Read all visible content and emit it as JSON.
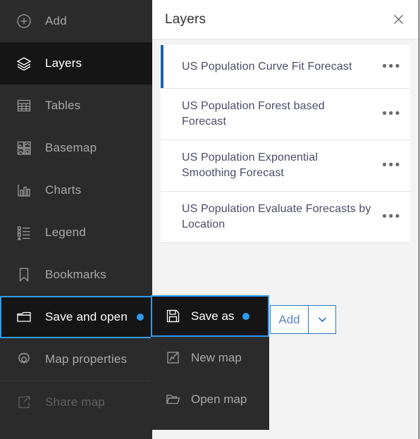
{
  "sidebar": {
    "items": [
      {
        "label": "Add",
        "icon": "plus-circle-icon",
        "state": "normal"
      },
      {
        "label": "Layers",
        "icon": "layers-icon",
        "state": "active"
      },
      {
        "label": "Tables",
        "icon": "table-icon",
        "state": "normal"
      },
      {
        "label": "Basemap",
        "icon": "basemap-icon",
        "state": "normal"
      },
      {
        "label": "Charts",
        "icon": "charts-icon",
        "state": "normal"
      },
      {
        "label": "Legend",
        "icon": "legend-icon",
        "state": "normal"
      },
      {
        "label": "Bookmarks",
        "icon": "bookmark-icon",
        "state": "normal"
      },
      {
        "label": "Save and open",
        "icon": "folder-icon",
        "state": "active-focused"
      },
      {
        "label": "Map properties",
        "icon": "gear-icon",
        "state": "normal"
      },
      {
        "label": "Share map",
        "icon": "share-icon",
        "state": "disabled"
      }
    ]
  },
  "panel": {
    "title": "Layers",
    "close_icon": "close-icon",
    "layers": [
      {
        "name": "US Population Curve Fit Forecast",
        "selected": true,
        "menu": "•••"
      },
      {
        "name": "US Population Forest based Forecast",
        "selected": false,
        "menu": "•••"
      },
      {
        "name": "US Population Exponential Smoothing Forecast",
        "selected": false,
        "menu": "•••"
      },
      {
        "name": "US Population Evaluate Forecasts by Location",
        "selected": false,
        "menu": "•••"
      }
    ],
    "add_button": {
      "label": "Add",
      "caret_icon": "chevron-down-icon"
    }
  },
  "dropdown": {
    "items": [
      {
        "label": "Save as",
        "icon": "floppy-disk-icon",
        "active": true,
        "badge": true
      },
      {
        "label": "New map",
        "icon": "new-map-icon",
        "active": false,
        "badge": false
      },
      {
        "label": "Open map",
        "icon": "open-folder-icon",
        "active": false,
        "badge": false
      }
    ]
  },
  "colors": {
    "accent_blue": "#2e9bf0",
    "selected_layer_bar": "#2064ad",
    "button_border": "#2f78c4",
    "sidebar_bg": "#2b2b2b",
    "sidebar_active_bg": "#151515",
    "panel_bg": "#f3f3f3"
  }
}
